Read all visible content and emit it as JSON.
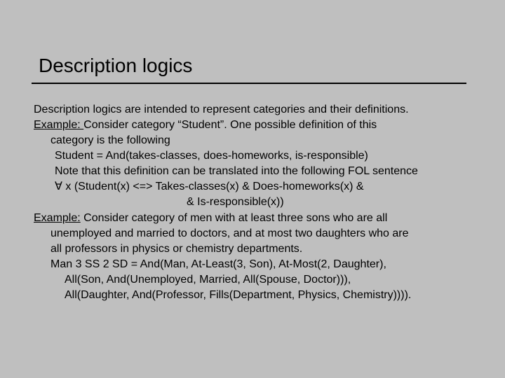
{
  "title": "Description logics",
  "lines": {
    "l1a": "Description logics are intended to represent categories and their definitions.",
    "l2_label": "Example: ",
    "l2_rest": " Consider category “Student”. One possible definition of this",
    "l3": "category is the following",
    "l4": "Student = And(takes-classes, does-homeworks, is-responsible)",
    "l5": "Note that this definition can be translated into the following FOL sentence",
    "l6": "∀ x (Student(x) <=> Takes-classes(x) & Does-homeworks(x) &",
    "l7": "& Is-responsible(x))",
    "l8_label": "Example:",
    "l8_rest": " Consider category of men with at least three sons who are all",
    "l9": "unemployed and married to doctors, and at most two daughters who are",
    "l10": "all professors in physics or chemistry departments.",
    "l11": "Man 3 SS 2 SD = And(Man, At-Least(3, Son), At-Most(2, Daughter),",
    "l12": "All(Son, And(Unemployed, Married, All(Spouse, Doctor))),",
    "l13": "All(Daughter, And(Professor, Fills(Department, Physics, Chemistry))))."
  }
}
